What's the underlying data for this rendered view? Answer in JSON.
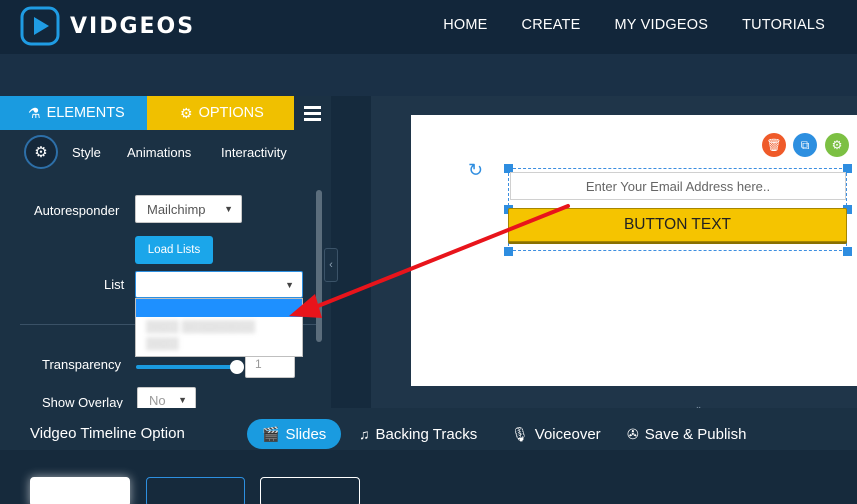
{
  "header": {
    "brand": "VIDGEOS",
    "nav": [
      "HOME",
      "CREATE",
      "MY VIDGEOS",
      "TUTORIALS"
    ]
  },
  "sidebar": {
    "tabs": {
      "elements": "ELEMENTS",
      "options": "OPTIONS"
    },
    "subtabs": [
      "Style",
      "Animations",
      "Interactivity"
    ],
    "autoresponder": {
      "label": "Autoresponder",
      "value": "Mailchimp"
    },
    "load_lists_label": "Load Lists",
    "list": {
      "label": "List",
      "value": ""
    },
    "transparency": {
      "label": "Transparency",
      "value": "1"
    },
    "show_overlay": {
      "label": "Show Overlay",
      "value": "No"
    }
  },
  "canvas": {
    "email_placeholder": "Enter Your Email Address here..",
    "button_text": "BUTTON TEXT",
    "toolbar_colors": {
      "delete": "#ef5a29",
      "copy": "#2d8fe0",
      "settings": "#7cc043"
    }
  },
  "timeline": {
    "title": "Vidgeo Timeline Option",
    "tabs": [
      "Slides",
      "Backing Tracks",
      "Voiceover",
      "Save & Publish"
    ],
    "active_tab": "Slides"
  },
  "colors": {
    "accent_blue": "#1a9be0",
    "accent_yellow": "#f0c000",
    "annotation_arrow": "#e8141b"
  }
}
